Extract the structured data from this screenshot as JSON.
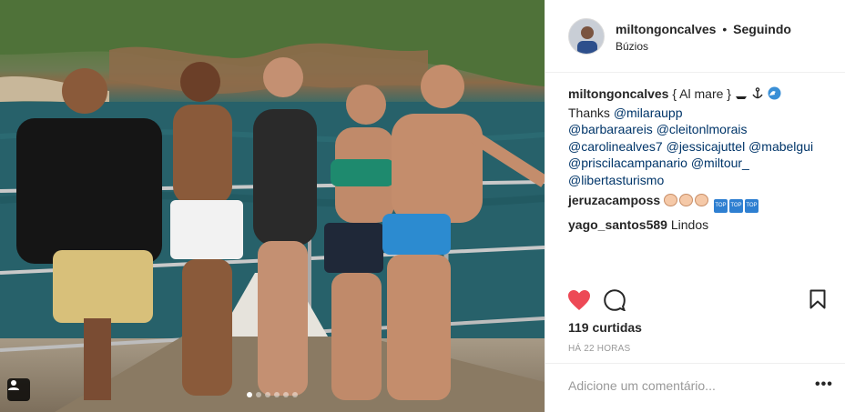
{
  "post": {
    "username": "miltongoncalves",
    "separator": "•",
    "follow_status": "Seguindo",
    "location": "Búzios"
  },
  "caption": {
    "username": "miltongoncalves",
    "text": "{ Al mare }",
    "emojis": [
      "boat-emoji",
      "anchor-emoji",
      "wave-emoji"
    ],
    "thanks_word": "Thanks",
    "mentions": [
      "@milaraupp",
      "@barbaraareis",
      "@cleitonlmorais",
      "@carolinealves7",
      "@jessicajuttel",
      "@mabelgui",
      "@priscilacampanario",
      "@miltour_",
      "@libertasturismo"
    ]
  },
  "comments": [
    {
      "username": "jeruzacamposs",
      "text": "",
      "emojis": [
        "clap-emoji",
        "clap-emoji",
        "clap-emoji",
        "top-emoji",
        "top-emoji",
        "top-emoji"
      ]
    },
    {
      "username": "yago_santos589",
      "text": "Lindos"
    }
  ],
  "actions": {
    "like_icon": "heart-filled-icon",
    "comment_icon": "comment-icon",
    "save_icon": "bookmark-icon",
    "like_color": "#ed4956"
  },
  "likes_text": "119 curtidas",
  "time_text": "HÁ 22 HORAS",
  "comment_box": {
    "placeholder": "Adicione um comentário...",
    "more_label": "•••"
  },
  "carousel": {
    "count": 6,
    "active_index": 0
  }
}
